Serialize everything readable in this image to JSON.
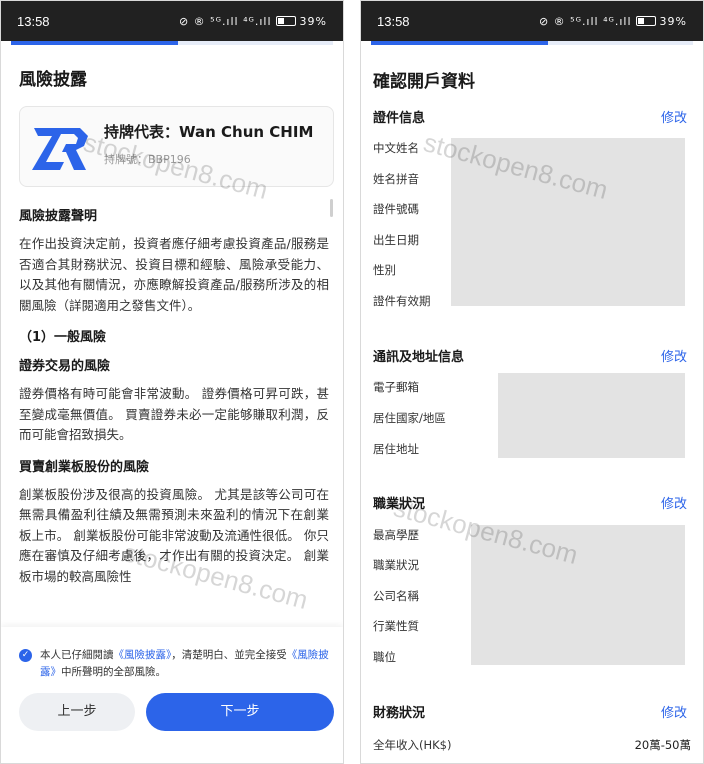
{
  "status_bar": {
    "time": "13:58",
    "icons": "⊘ ® ⁵ᴳ.ıll ⁴ᴳ.ıll",
    "battery": "39%"
  },
  "colors": {
    "accent": "#2c64e9",
    "mask": "#e3e3e3"
  },
  "left": {
    "progress": 0.52,
    "title": "風險披露",
    "rep": {
      "name": "持牌代表：Wan Chun CHIM",
      "license": "持牌號：BBP196",
      "logo_icon": "zr-logo-icon"
    },
    "watermark": "stockopen8.com",
    "sections": [
      {
        "heading": "風險披露聲明",
        "text": "在作出投資決定前，投資者應仔細考慮投資產品/服務是否適合其財務狀況、投資目標和經驗、風險承受能力、以及其他有關情況，亦應瞭解投資產品/服務所涉及的相關風險（詳閱適用之發售文件）。"
      },
      {
        "heading": "（1）一般風險",
        "text": ""
      },
      {
        "heading": "證券交易的風險",
        "text": "證券價格有時可能會非常波動。 證券價格可昇可跌，甚至變成毫無價值。 買賣證券未必一定能够賺取利潤，反而可能會招致損失。"
      },
      {
        "heading": "買賣創業板股份的風險",
        "text": "創業板股份涉及很高的投資風險。 尤其是該等公司可在無需具備盈利往績及無需預測未來盈利的情況下在創業板上市。 創業板股份可能非常波動及流通性很低。 你只應在審慎及仔細考慮後，才作出有關的投資決定。 創業板市場的較高風險性"
      }
    ],
    "agree": {
      "prefix": "本人已仔細閱讀",
      "link1": "《風險披露》",
      "middle": "，清楚明白、並完全接受",
      "link2": "《風險披露》",
      "suffix": "中所聲明的全部風險。",
      "checked": true
    },
    "buttons": {
      "prev": "上一步",
      "next": "下一步"
    }
  },
  "right": {
    "progress": 0.55,
    "title": "確認開戶資料",
    "edit_label": "修改",
    "groups": [
      {
        "title": "證件信息",
        "fields": [
          "中文姓名",
          "姓名拼音",
          "證件號碼",
          "出生日期",
          "性別",
          "證件有效期"
        ]
      },
      {
        "title": "通訊及地址信息",
        "fields": [
          "電子郵箱",
          "居住國家/地區",
          "居住地址"
        ]
      },
      {
        "title": "職業狀況",
        "fields": [
          "最高學歷",
          "職業狀況",
          "公司名稱",
          "行業性質",
          "職位"
        ]
      },
      {
        "title": "財務狀況",
        "fields": [
          "全年收入(HK$)"
        ],
        "values": [
          "20萬-50萬"
        ]
      }
    ]
  }
}
